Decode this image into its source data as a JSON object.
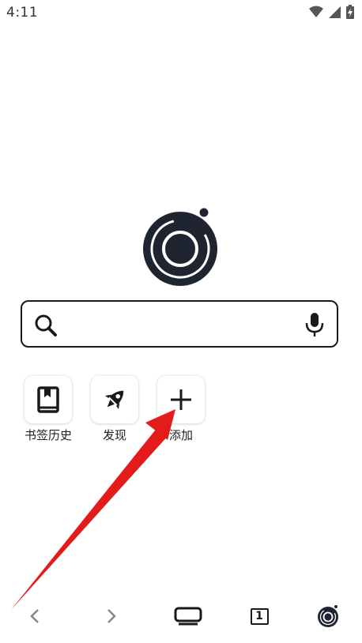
{
  "status_bar": {
    "time": "4:11",
    "icons": [
      "wifi-icon",
      "cellular-signal-icon",
      "battery-charging-icon"
    ]
  },
  "logo": {
    "icon": "browser-logo-icon",
    "color": "#1e2530"
  },
  "search": {
    "value": "",
    "placeholder": "",
    "left_icon": "search-icon",
    "right_icon": "microphone-icon"
  },
  "shortcuts": [
    {
      "label": "书签历史",
      "icon": "bookmark-book-icon"
    },
    {
      "label": "发现",
      "icon": "rocket-icon"
    },
    {
      "label": "添加",
      "icon": "plus-icon"
    }
  ],
  "annotation": {
    "type": "red-arrow",
    "color": "#e31b1b",
    "points_to": "添加"
  },
  "bottom_nav": {
    "back_icon": "back-chevron-icon",
    "forward_icon": "forward-chevron-icon",
    "screen_icon": "screen-mode-icon",
    "tab_count": "1",
    "menu_icon": "browser-logo-icon"
  }
}
